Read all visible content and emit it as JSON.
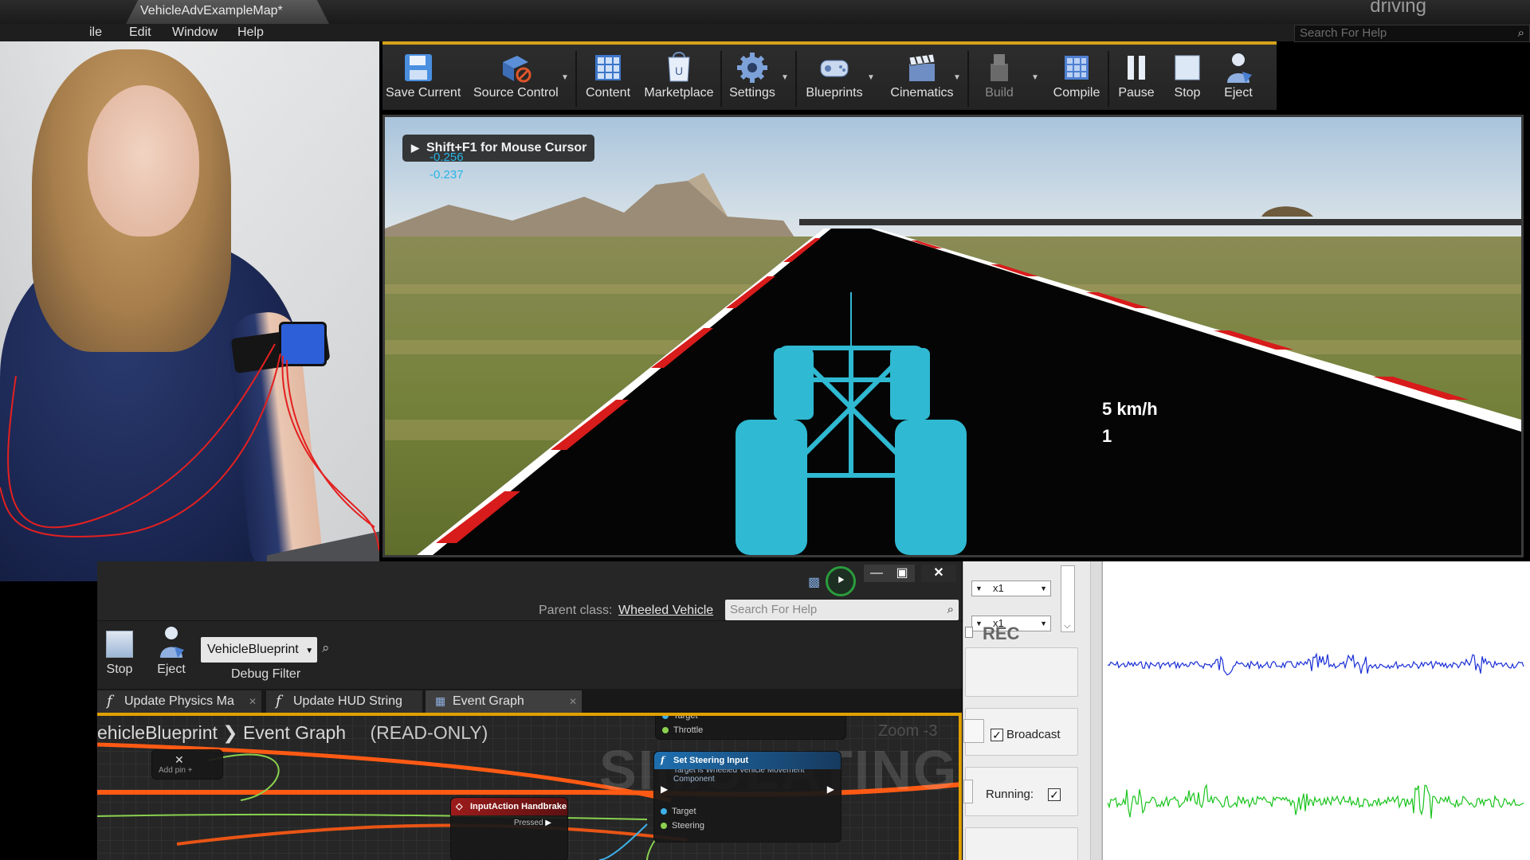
{
  "window": {
    "doc_tab": "VehicleAdvExampleMap*",
    "title_right": "driving",
    "help_search_placeholder": "Search For Help"
  },
  "menu": [
    "ile",
    "Edit",
    "Window",
    "Help"
  ],
  "toolbar": {
    "buttons": [
      {
        "label": "Save Current",
        "icon": "save-icon"
      },
      {
        "label": "Source Control",
        "icon": "source-control-icon"
      },
      {
        "label": "Content",
        "icon": "content-icon"
      },
      {
        "label": "Marketplace",
        "icon": "marketplace-icon"
      },
      {
        "label": "Settings",
        "icon": "settings-icon"
      },
      {
        "label": "Blueprints",
        "icon": "blueprints-icon"
      },
      {
        "label": "Cinematics",
        "icon": "cinematics-icon"
      },
      {
        "label": "Build",
        "icon": "build-icon"
      },
      {
        "label": "Compile",
        "icon": "compile-icon"
      },
      {
        "label": "Pause",
        "icon": "pause-icon"
      },
      {
        "label": "Stop",
        "icon": "stop-icon"
      },
      {
        "label": "Eject",
        "icon": "eject-icon"
      }
    ]
  },
  "viewport": {
    "mouse_hint": "Shift+F1 for Mouse Cursor",
    "debug_values": [
      "-0.256",
      "-0.237"
    ],
    "speed": "5 km/h",
    "gear": "1",
    "colors": {
      "sky": "#b9cfe0",
      "road": "#050505",
      "curb_red": "#d81b1b",
      "car": "#2fb9d2"
    }
  },
  "blueprint": {
    "parent_class_label": "Parent class:",
    "parent_class_value": "Wheeled Vehicle",
    "search_placeholder": "Search For Help",
    "stop_label": "Stop",
    "eject_label": "Eject",
    "debug_object": "VehicleBlueprint",
    "debug_filter_label": "Debug Filter",
    "tabs": [
      {
        "label": "Update Physics Ma",
        "icon": "function-icon"
      },
      {
        "label": "Update HUD String",
        "icon": "function-icon"
      },
      {
        "label": "Event Graph",
        "icon": "event-graph-icon"
      }
    ],
    "breadcrumb": {
      "blueprint": "ehicleBlueprint",
      "graph": "Event Graph",
      "mode": "(READ-ONLY)"
    },
    "watermark": "SIMULATING",
    "zoom_label": "Zoom -3",
    "nodes": {
      "top_pins": [
        "Target",
        "Throttle"
      ],
      "add_pin": "Add pin",
      "steering_title": "Set Steering Input",
      "steering_subtitle": "Target is Wheeled Vehicle Movement Component",
      "steering_pins": [
        "Target",
        "Steering"
      ],
      "handbrake_title": "InputAction Handbrake",
      "handbrake_pin": "Pressed"
    }
  },
  "biosignal": {
    "multiplier_1": "x1",
    "multiplier_2": "x1",
    "rec_label": "REC",
    "broadcast_label": "Broadcast",
    "broadcast_checked": true,
    "running_label": "Running:",
    "running_checked": true,
    "channel_colors": [
      "#1a2fd6",
      "#19c41c"
    ]
  }
}
